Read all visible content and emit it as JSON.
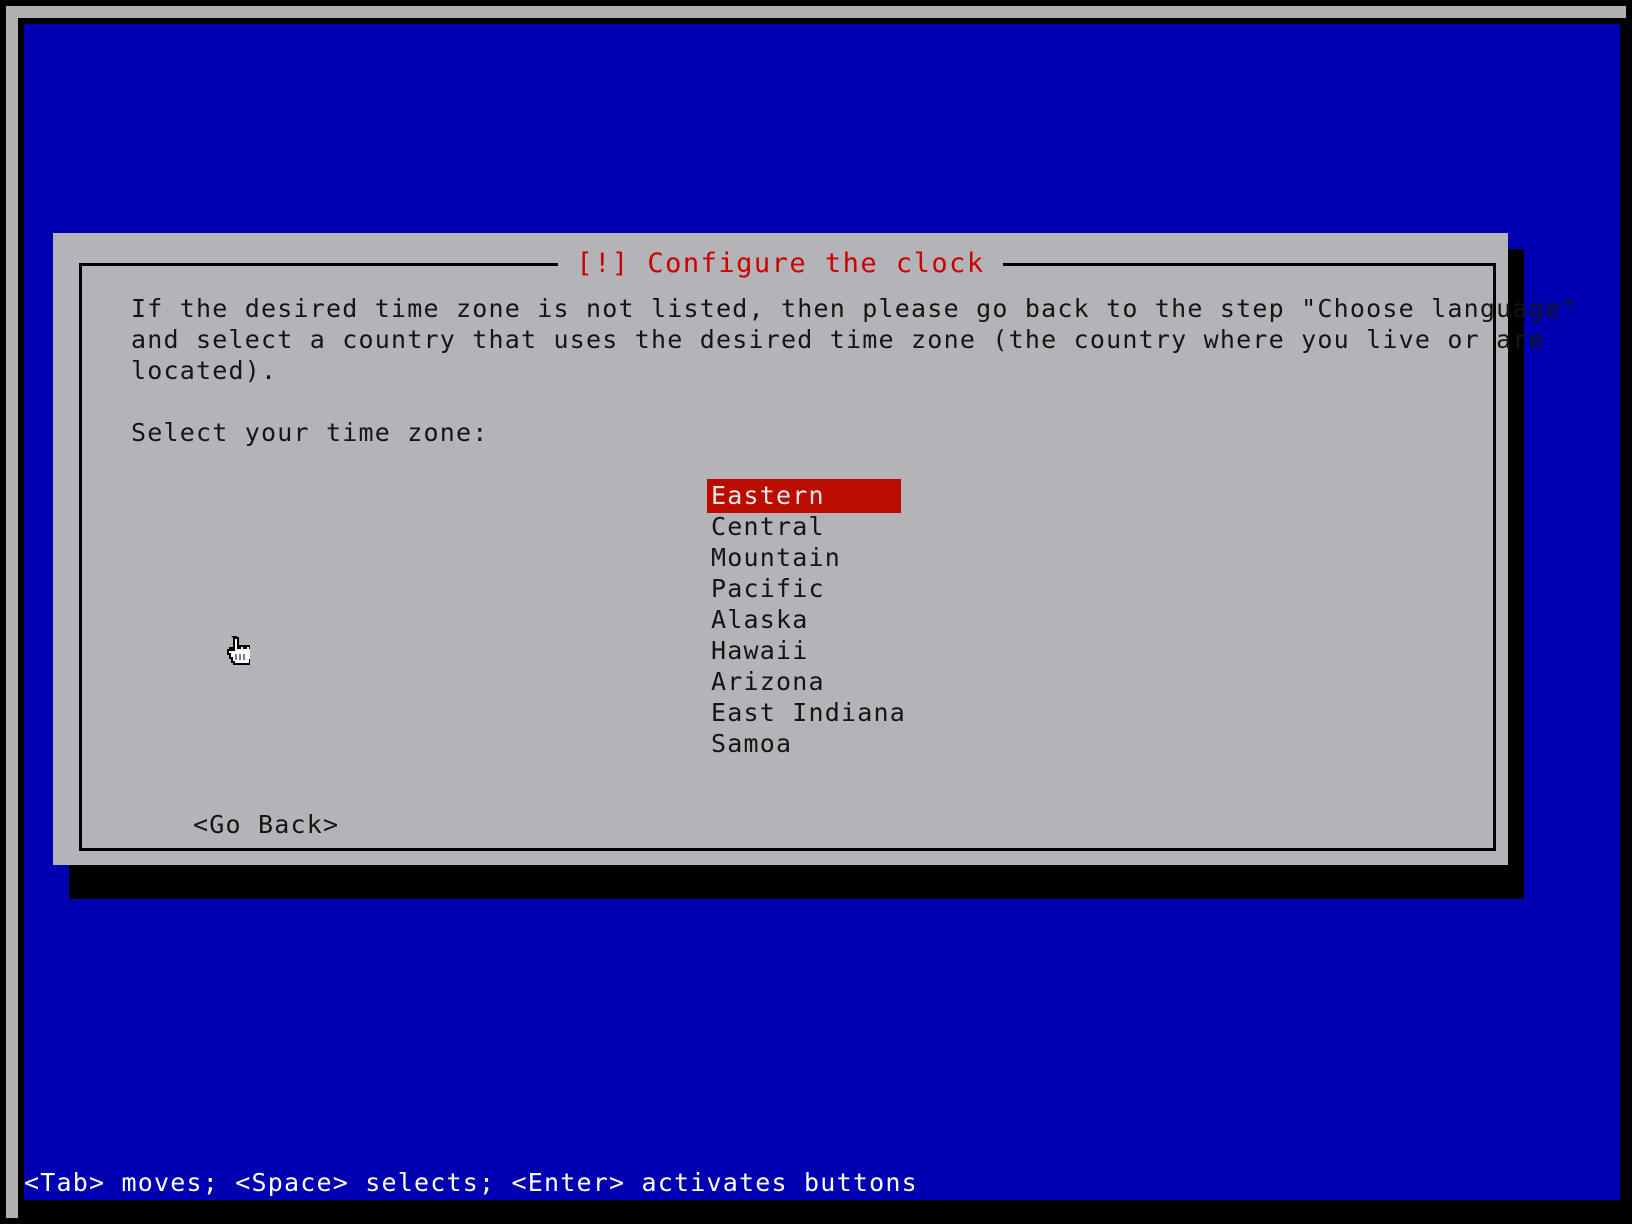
{
  "screen": {
    "background_color": "#0000b3",
    "shadow_color": "#000000"
  },
  "dialog": {
    "title": "[!] Configure the clock",
    "title_color": "#cc0000",
    "background_color": "#b3b3b8",
    "border_color": "#000000",
    "paragraph_lines": [
      "If the desired time zone is not listed, then please go back to the step \"Choose language\"",
      "and select a country that uses the desired time zone (the country where you live or are",
      "located)."
    ],
    "prompt": "Select your time zone:",
    "list": {
      "selected_index": 0,
      "selected_bg_color": "#bb0c00",
      "selected_fg_color": "#e8e8e8",
      "items": [
        "Eastern",
        "Central",
        "Mountain",
        "Pacific",
        "Alaska",
        "Hawaii",
        "Arizona",
        "East Indiana",
        "Samoa"
      ]
    },
    "buttons": [
      "<Go Back>"
    ]
  },
  "statusbar": {
    "text": "<Tab> moves; <Space> selects; <Enter> activates buttons",
    "color": "#ffffff"
  },
  "cursor": {
    "icon": "pointing-hand-cursor"
  }
}
